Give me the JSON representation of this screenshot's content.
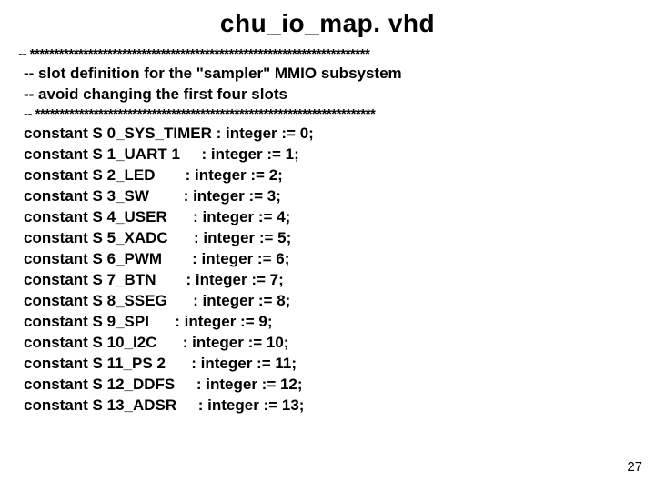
{
  "title": "chu_io_map. vhd",
  "sep1": "-- **********************************************************************",
  "comment1": "-- slot definition for the \"sampler\" MMIO subsystem",
  "comment2": "-- avoid changing the first four slots",
  "sep2": "-- **********************************************************************",
  "lines": [
    {
      "text": "constant S 0_SYS_TIMER : integer := 0;",
      "bold": false
    },
    {
      "text": "constant S 1_UART 1     : integer := 1;",
      "bold": false
    },
    {
      "text": "constant S 2_LED       : integer := 2;",
      "bold": false
    },
    {
      "text": "constant S 3_SW        : integer := 3;",
      "bold": false
    },
    {
      "text": "constant S 4_USER      : integer := 4;",
      "bold": true
    },
    {
      "text": "constant S 5_XADC      : integer := 5;",
      "bold": false
    },
    {
      "text": "constant S 6_PWM       : integer := 6;",
      "bold": false
    },
    {
      "text": "constant S 7_BTN       : integer := 7;",
      "bold": false
    },
    {
      "text": "constant S 8_SSEG      : integer := 8;",
      "bold": false
    },
    {
      "text": "constant S 9_SPI      : integer := 9;",
      "bold": false
    },
    {
      "text": "constant S 10_I2C      : integer := 10;",
      "bold": false
    },
    {
      "text": "constant S 11_PS 2      : integer := 11;",
      "bold": false
    },
    {
      "text": "constant S 12_DDFS     : integer := 12;",
      "bold": false
    },
    {
      "text": "constant S 13_ADSR     : integer := 13;",
      "bold": false
    }
  ],
  "page": "27"
}
